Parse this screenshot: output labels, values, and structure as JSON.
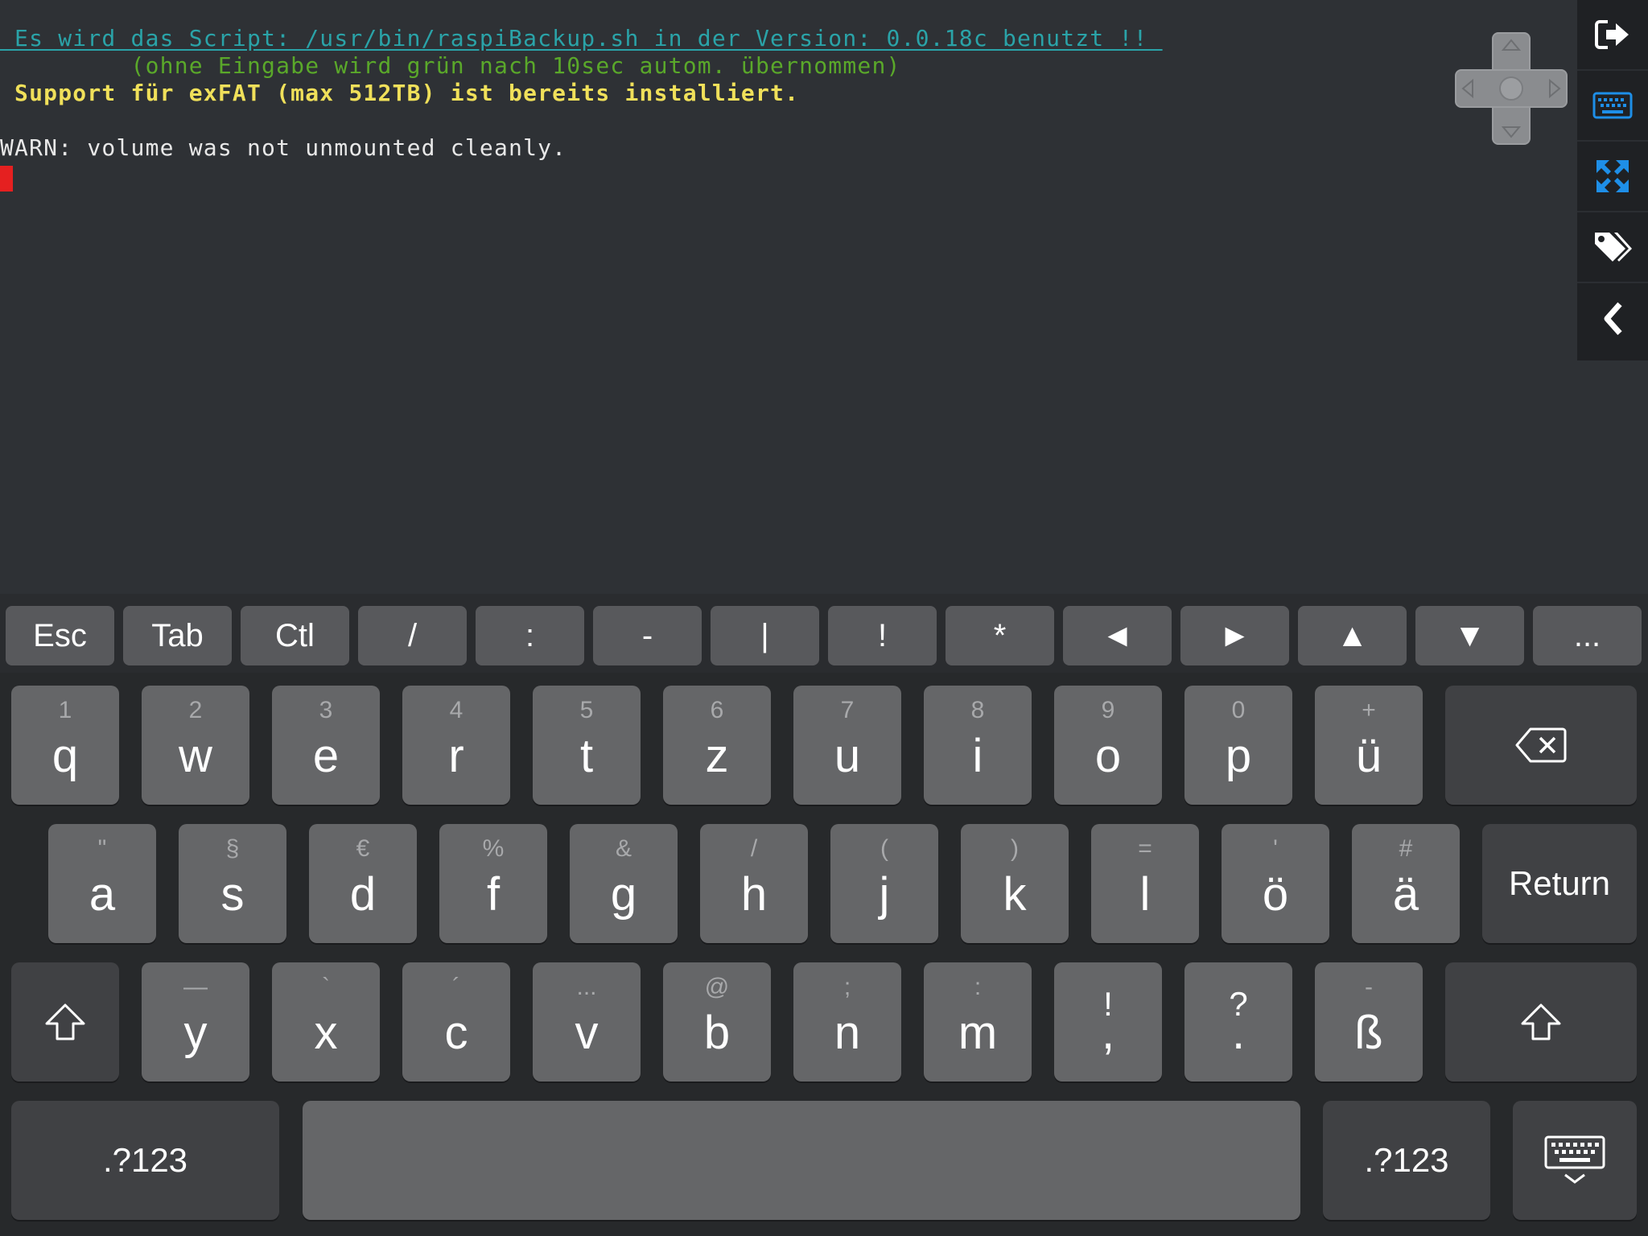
{
  "terminal": {
    "line1": " Es wird das Script: /usr/bin/raspiBackup.sh in der Version: 0.0.18c benutzt !! ",
    "line2": "         (ohne Eingabe wird grün nach 10sec autom. übernommen)",
    "line3": " Support für exFAT (max 512TB) ist bereits installiert.",
    "line4": "WARN: volume was not unmounted cleanly."
  },
  "sidebar": {
    "icons": [
      "exit-icon",
      "keyboard-icon",
      "fullscreen-icon",
      "tags-icon",
      "chevron-left-icon"
    ],
    "accent": "#1e8fe8"
  },
  "accessory_keys": [
    "Esc",
    "Tab",
    "Ctl",
    "/",
    ":",
    "-",
    "|",
    "!",
    "*",
    "◄",
    "►",
    "▲",
    "▼",
    "..."
  ],
  "keyboard": {
    "row1": [
      {
        "sec": "1",
        "pri": "q"
      },
      {
        "sec": "2",
        "pri": "w"
      },
      {
        "sec": "3",
        "pri": "e"
      },
      {
        "sec": "4",
        "pri": "r"
      },
      {
        "sec": "5",
        "pri": "t"
      },
      {
        "sec": "6",
        "pri": "z"
      },
      {
        "sec": "7",
        "pri": "u"
      },
      {
        "sec": "8",
        "pri": "i"
      },
      {
        "sec": "9",
        "pri": "o"
      },
      {
        "sec": "0",
        "pri": "p"
      },
      {
        "sec": "+",
        "pri": "ü"
      }
    ],
    "row2": [
      {
        "sec": "\"",
        "pri": "a"
      },
      {
        "sec": "§",
        "pri": "s"
      },
      {
        "sec": "€",
        "pri": "d"
      },
      {
        "sec": "%",
        "pri": "f"
      },
      {
        "sec": "&",
        "pri": "g"
      },
      {
        "sec": "/",
        "pri": "h"
      },
      {
        "sec": "(",
        "pri": "j"
      },
      {
        "sec": ")",
        "pri": "k"
      },
      {
        "sec": "=",
        "pri": "l"
      },
      {
        "sec": "'",
        "pri": "ö"
      },
      {
        "sec": "#",
        "pri": "ä"
      }
    ],
    "row3": [
      {
        "sec": "—",
        "pri": "y"
      },
      {
        "sec": "`",
        "pri": "x"
      },
      {
        "sec": "´",
        "pri": "c"
      },
      {
        "sec": "...",
        "pri": "v"
      },
      {
        "sec": "@",
        "pri": "b"
      },
      {
        "sec": ";",
        "pri": "n"
      },
      {
        "sec": ":",
        "pri": "m"
      },
      {
        "sec": "!",
        "pri": ","
      },
      {
        "sec": "?",
        "pri": "."
      },
      {
        "sec": "-",
        "pri": "ß"
      }
    ],
    "return_label": "Return",
    "numbers_label": ".?123",
    "numbers_label_right": ".?123"
  },
  "colors": {
    "terminal_bg": "#2e3135",
    "cyan": "#2aa3a8",
    "green": "#5aa82a",
    "yellow": "#f0e05a",
    "cursor": "#e52020"
  }
}
